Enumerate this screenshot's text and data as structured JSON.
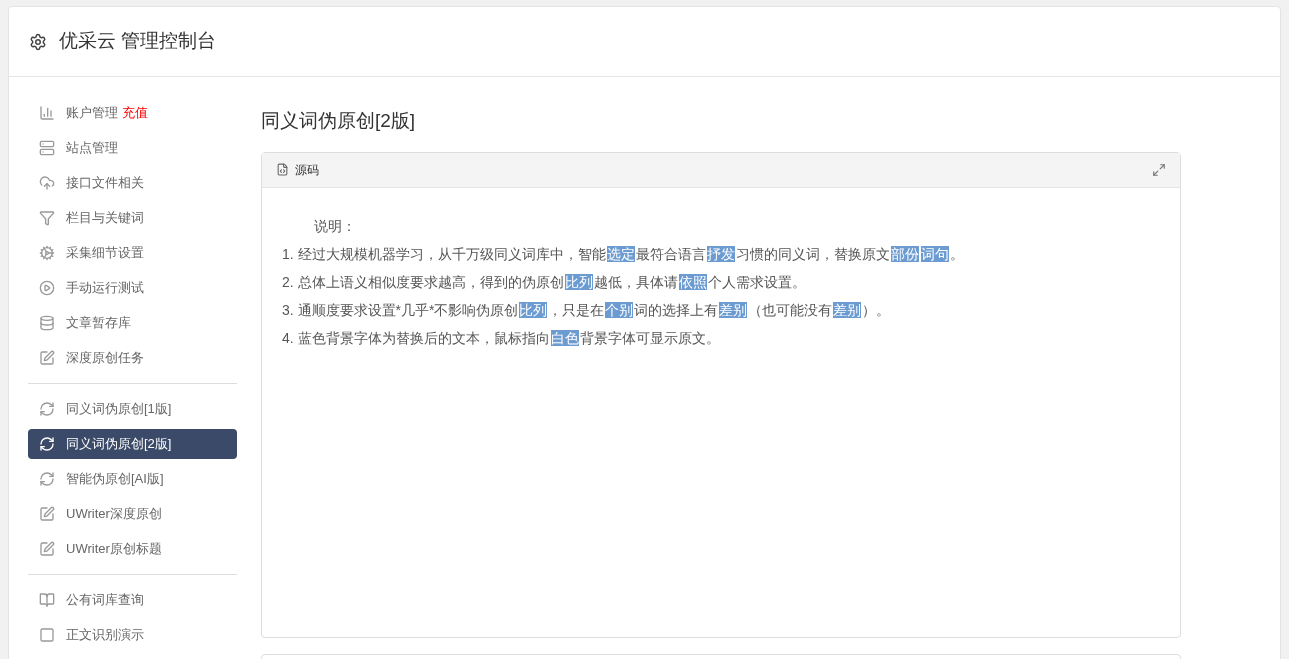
{
  "header": {
    "title": "优采云 管理控制台"
  },
  "sidebar": {
    "groups": [
      {
        "items": [
          {
            "label": "账户管理",
            "kind": "chart",
            "badge": "充值",
            "selected": false
          },
          {
            "label": "站点管理",
            "kind": "server",
            "selected": false
          },
          {
            "label": "接口文件相关",
            "kind": "cloud",
            "selected": false
          },
          {
            "label": "栏目与关键词",
            "kind": "filter",
            "selected": false
          },
          {
            "label": "采集细节设置",
            "kind": "cogs",
            "selected": false
          },
          {
            "label": "手动运行测试",
            "kind": "play",
            "selected": false
          },
          {
            "label": "文章暂存库",
            "kind": "database",
            "selected": false
          },
          {
            "label": "深度原创任务",
            "kind": "edit",
            "selected": false
          }
        ]
      },
      {
        "items": [
          {
            "label": "同义词伪原创[1版]",
            "kind": "refresh",
            "selected": false
          },
          {
            "label": "同义词伪原创[2版]",
            "kind": "refresh",
            "selected": true
          },
          {
            "label": "智能伪原创[AI版]",
            "kind": "refresh",
            "selected": false
          },
          {
            "label": "UWriter深度原创",
            "kind": "edit",
            "selected": false
          },
          {
            "label": "UWriter原创标题",
            "kind": "edit",
            "selected": false
          }
        ]
      },
      {
        "items": [
          {
            "label": "公有词库查询",
            "kind": "book",
            "selected": false
          },
          {
            "label": "正文识别演示",
            "kind": "square",
            "selected": false
          }
        ]
      }
    ]
  },
  "page_title": "同义词伪原创[2版]",
  "editor": {
    "toolbar_button": "源码",
    "heading": "说明：",
    "lines": [
      [
        {
          "text": "1. 经过大规模机器学习，从千万级同义词库中，智能",
          "replaced": false
        },
        {
          "text": "选定",
          "replaced": true
        },
        {
          "text": "最符合语言",
          "replaced": false
        },
        {
          "text": "抒发",
          "replaced": true
        },
        {
          "text": "习惯的同义词，替换原文",
          "replaced": false
        },
        {
          "text": "部份",
          "replaced": true
        },
        {
          "text": "词句",
          "replaced": true
        },
        {
          "text": "。",
          "replaced": false
        }
      ],
      [
        {
          "text": "2. 总体上语义相似度要求越高，得到的伪原创",
          "replaced": false
        },
        {
          "text": "比列",
          "replaced": true
        },
        {
          "text": "越低，具体请",
          "replaced": false
        },
        {
          "text": "依照",
          "replaced": true
        },
        {
          "text": "个人需求设置。",
          "replaced": false
        }
      ],
      [
        {
          "text": "3. 通顺度要求设置*几乎*不影响伪原创",
          "replaced": false
        },
        {
          "text": "比列",
          "replaced": true
        },
        {
          "text": "，只是在",
          "replaced": false
        },
        {
          "text": "个别",
          "replaced": true
        },
        {
          "text": "词的选择上有",
          "replaced": false
        },
        {
          "text": "差别",
          "replaced": true
        },
        {
          "text": "（也可能没有",
          "replaced": false
        },
        {
          "text": "差别",
          "replaced": true
        },
        {
          "text": "）。",
          "replaced": false
        }
      ],
      [
        {
          "text": "4. 蓝色背景字体为替换后的文本，鼠标指向",
          "replaced": false
        },
        {
          "text": "白色",
          "replaced": true
        },
        {
          "text": "背景字体可显示原文。",
          "replaced": false
        }
      ]
    ]
  }
}
